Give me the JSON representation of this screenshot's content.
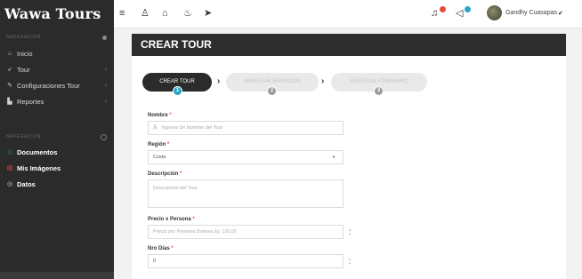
{
  "sidebar": {
    "brand": "Wawa Tours",
    "section1": "NAVEGACION",
    "section2": "NAVEGACION",
    "items": [
      {
        "label": "Inicio"
      },
      {
        "label": "Tour"
      },
      {
        "label": "Configuraciones Tour"
      },
      {
        "label": "Reportes"
      }
    ],
    "items2": [
      {
        "label": "Documentos"
      },
      {
        "label": "Mis Imágenes"
      },
      {
        "label": "Datos"
      }
    ]
  },
  "topbar": {
    "user_name": "Gandhy Cuasapas",
    "icons": [
      "menu-icon",
      "user-icon",
      "bank-icon",
      "fire-icon",
      "send-icon",
      "bell-icon",
      "megaphone-icon"
    ],
    "colors": {
      "bell_badge": "#e04b3a",
      "megaphone_badge": "#27a7c9"
    }
  },
  "panel": {
    "title": "CREAR TOUR",
    "steps": [
      {
        "label": "CREAR TOUR",
        "num": "1"
      },
      {
        "label": "AGREGAR SERVICIOS",
        "num": "2"
      },
      {
        "label": "AGREGAR ITINERARIO",
        "num": "3"
      }
    ]
  },
  "form": {
    "nombre_label": "Nombre",
    "nombre_placeholder": "Ingresa Un Nombre del Tour",
    "region_label": "Región",
    "region_value": "Costa",
    "descripcion_label": "Descripción",
    "descripcion_placeholder": "Descripción del Tour",
    "precio_label": "Precio x Persona",
    "precio_placeholder": "Precio por Persona Dolares Ej: 120.00",
    "dias_label": "Nro Días",
    "dias_value": "0",
    "required_mark": "*"
  }
}
